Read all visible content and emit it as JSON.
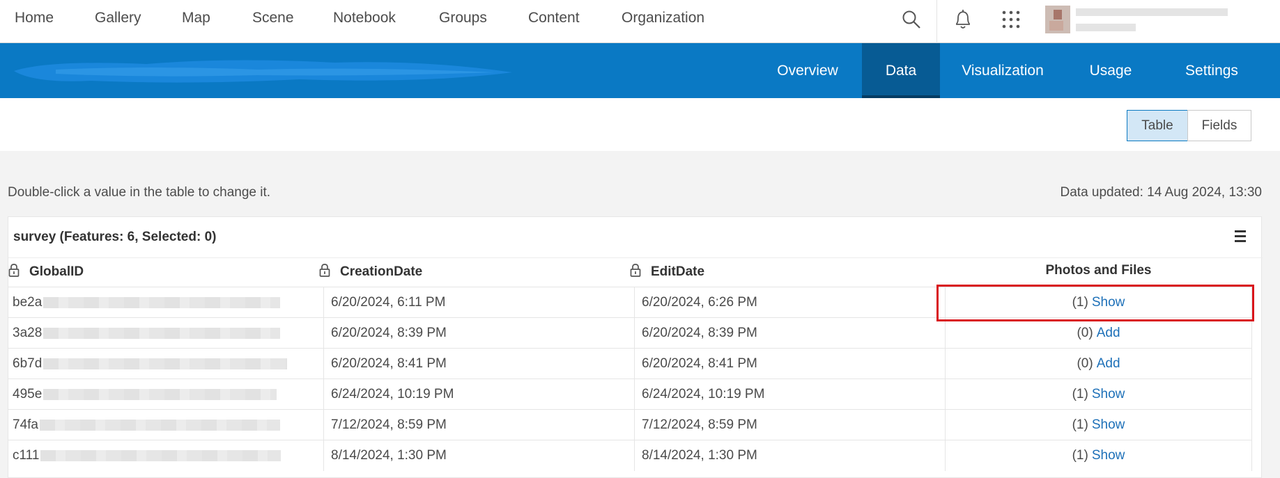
{
  "topnav": {
    "links": [
      "Home",
      "Gallery",
      "Map",
      "Scene",
      "Notebook",
      "Groups",
      "Content",
      "Organization"
    ],
    "icons": [
      "search-icon",
      "bell-icon",
      "apps-grid-icon"
    ]
  },
  "item_header": {
    "tabs": [
      "Overview",
      "Data",
      "Visualization",
      "Usage",
      "Settings"
    ],
    "active_tab": "Data"
  },
  "view_toggle": {
    "table_label": "Table",
    "fields_label": "Fields",
    "selected": "Table"
  },
  "hint": "Double-click a value in the table to change it.",
  "updated": "Data updated: 14 Aug 2024, 13:30",
  "table": {
    "title": "survey (Features: 6, Selected: 0)",
    "columns": [
      "GlobalID",
      "CreationDate",
      "EditDate",
      "Photos and Files"
    ],
    "rows": [
      {
        "globalid": "be2a",
        "created": "6/20/2024, 6:11 PM",
        "edited": "6/20/2024, 6:26 PM",
        "count": "(1)",
        "action": "Show"
      },
      {
        "globalid": "3a28",
        "created": "6/20/2024, 8:39 PM",
        "edited": "6/20/2024, 8:39 PM",
        "count": "(0)",
        "action": "Add"
      },
      {
        "globalid": "6b7d",
        "created": "6/20/2024, 8:41 PM",
        "edited": "6/20/2024, 8:41 PM",
        "count": "(0)",
        "action": "Add"
      },
      {
        "globalid": "495e",
        "created": "6/24/2024, 10:19 PM",
        "edited": "6/24/2024, 10:19 PM",
        "count": "(1)",
        "action": "Show"
      },
      {
        "globalid": "74fa",
        "created": "7/12/2024, 8:59 PM",
        "edited": "7/12/2024, 8:59 PM",
        "count": "(1)",
        "action": "Show"
      },
      {
        "globalid": "c111",
        "created": "8/14/2024, 1:30 PM",
        "edited": "8/14/2024, 1:30 PM",
        "count": "(1)",
        "action": "Show"
      }
    ]
  },
  "colors": {
    "brand_blue": "#0a79c4",
    "active_tab": "#075b94",
    "link": "#1d70b8",
    "highlight": "#d9151b"
  }
}
